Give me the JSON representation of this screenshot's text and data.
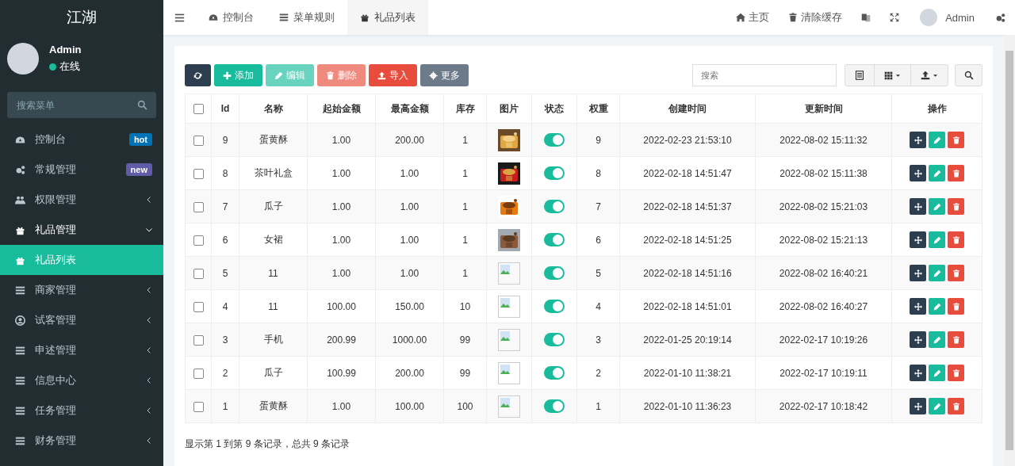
{
  "sidebar": {
    "logo": "江湖",
    "user": {
      "name": "Admin",
      "status": "在线",
      "online": true
    },
    "search": {
      "placeholder": "搜索菜单"
    },
    "items": [
      {
        "label": "控制台",
        "badge": {
          "text": "hot",
          "color": "#0073b7"
        },
        "selected": false
      },
      {
        "label": "常规管理",
        "badge": {
          "text": "new",
          "color": "#605ca8"
        },
        "selected": false
      },
      {
        "label": "权限管理",
        "expanded": false,
        "selected": false
      },
      {
        "label": "礼品管理",
        "expanded": true,
        "selected": false,
        "children": [
          {
            "label": "礼品列表",
            "selected": true
          }
        ]
      },
      {
        "label": "商家管理",
        "expanded": false,
        "selected": false
      },
      {
        "label": "试客管理",
        "expanded": false,
        "selected": false
      },
      {
        "label": "申述管理",
        "expanded": false,
        "selected": false
      },
      {
        "label": "信息中心",
        "expanded": false,
        "selected": false
      },
      {
        "label": "任务管理",
        "expanded": false,
        "selected": false
      },
      {
        "label": "财务管理",
        "expanded": false,
        "selected": false
      }
    ]
  },
  "topbar": {
    "tabs": [
      {
        "label": "控制台",
        "selected": false
      },
      {
        "label": "菜单规则",
        "selected": false
      },
      {
        "label": "礼品列表",
        "selected": true
      }
    ],
    "links": [
      "主页",
      "清除缓存"
    ],
    "user": "Admin"
  },
  "toolbar": {
    "buttons": [
      {
        "kind": "refresh",
        "disabled": false
      },
      {
        "kind": "add",
        "label": "添加",
        "disabled": false
      },
      {
        "kind": "edit",
        "label": "编辑",
        "disabled": true
      },
      {
        "kind": "delete",
        "label": "删除",
        "disabled": true
      },
      {
        "kind": "import",
        "label": "导入",
        "disabled": false
      },
      {
        "kind": "more",
        "label": "更多",
        "disabled": false
      }
    ],
    "search": {
      "placeholder": "搜索"
    }
  },
  "table": {
    "select_all_checked": false,
    "columns": [
      "Id",
      "名称",
      "起始金额",
      "最高金额",
      "库存",
      "图片",
      "状态",
      "权重",
      "创建时间",
      "更新时间",
      "操作"
    ],
    "rows": [
      {
        "checked": false,
        "id": "9",
        "name": "蛋黄酥",
        "min": "1.00",
        "max": "200.00",
        "stock": "1",
        "on": true,
        "weight": "9",
        "created": "2022-02-23 21:53:10",
        "updated": "2022-08-02 15:11:32"
      },
      {
        "checked": false,
        "id": "8",
        "name": "茶叶礼盒",
        "min": "1.00",
        "max": "1.00",
        "stock": "1",
        "on": true,
        "weight": "8",
        "created": "2022-02-18 14:51:47",
        "updated": "2022-08-02 15:11:38"
      },
      {
        "checked": false,
        "id": "7",
        "name": "瓜子",
        "min": "1.00",
        "max": "1.00",
        "stock": "1",
        "on": true,
        "weight": "7",
        "created": "2022-02-18 14:51:37",
        "updated": "2022-08-02 15:21:03"
      },
      {
        "checked": false,
        "id": "6",
        "name": "女裙",
        "min": "1.00",
        "max": "1.00",
        "stock": "1",
        "on": true,
        "weight": "6",
        "created": "2022-02-18 14:51:25",
        "updated": "2022-08-02 15:21:13"
      },
      {
        "checked": false,
        "id": "5",
        "name": "11",
        "min": "1.00",
        "max": "1.00",
        "stock": "1",
        "kind": "broken",
        "on": true,
        "weight": "5",
        "created": "2022-02-18 14:51:16",
        "updated": "2022-08-02 16:40:21"
      },
      {
        "checked": false,
        "id": "4",
        "name": "11",
        "min": "100.00",
        "max": "150.00",
        "stock": "10",
        "kind": "broken",
        "on": true,
        "weight": "4",
        "created": "2022-02-18 14:51:01",
        "updated": "2022-08-02 16:40:27"
      },
      {
        "checked": false,
        "id": "3",
        "name": "手机",
        "min": "200.99",
        "max": "1000.00",
        "stock": "99",
        "kind": "broken",
        "on": true,
        "weight": "3",
        "created": "2022-01-25 20:19:14",
        "updated": "2022-02-17 10:19:26"
      },
      {
        "checked": false,
        "id": "2",
        "name": "瓜子",
        "min": "100.99",
        "max": "200.00",
        "stock": "99",
        "kind": "broken",
        "on": true,
        "weight": "2",
        "created": "2022-01-10 11:38:21",
        "updated": "2022-02-17 10:19:11"
      },
      {
        "checked": false,
        "id": "1",
        "name": "蛋黄酥",
        "min": "1.00",
        "max": "100.00",
        "stock": "100",
        "kind": "broken",
        "on": true,
        "weight": "1",
        "created": "2022-01-10 11:36:23",
        "updated": "2022-02-17 10:18:42"
      }
    ]
  },
  "footer": "显示第 1 到第 9 条记录，总共 9 条记录"
}
